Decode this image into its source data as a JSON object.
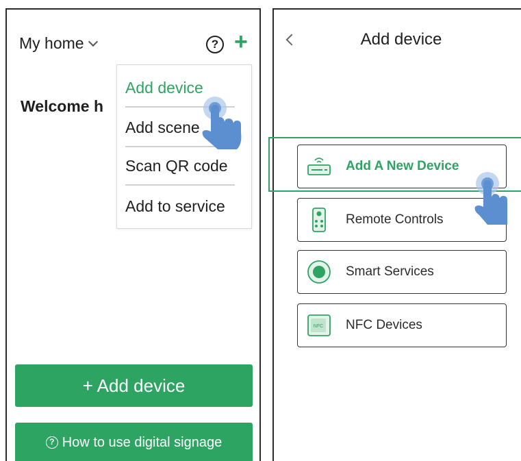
{
  "left_screen": {
    "home_title": "My home",
    "welcome": "Welcome h",
    "menu": {
      "items": [
        {
          "label": "Add device",
          "active": true
        },
        {
          "label": "Add scene"
        },
        {
          "label": "Scan QR code"
        },
        {
          "label": "Add to service"
        }
      ]
    },
    "add_device_button": "+ Add device",
    "howto_button": "How to use digital signage",
    "howto_icon_glyph": "?"
  },
  "right_screen": {
    "title": "Add device",
    "options": [
      {
        "label": "Add A New Device",
        "icon": "router-icon",
        "highlighted": true
      },
      {
        "label": "Remote Controls",
        "icon": "remote-control-icon"
      },
      {
        "label": "Smart Services",
        "icon": "smart-service-icon"
      },
      {
        "label": "NFC Devices",
        "icon": "nfc-icon"
      }
    ],
    "nfc_icon_text": "NFC"
  },
  "colors": {
    "accent_green": "#2ea463",
    "hand_blue": "#5b8fd0",
    "border_dark": "#2a2a2a"
  }
}
